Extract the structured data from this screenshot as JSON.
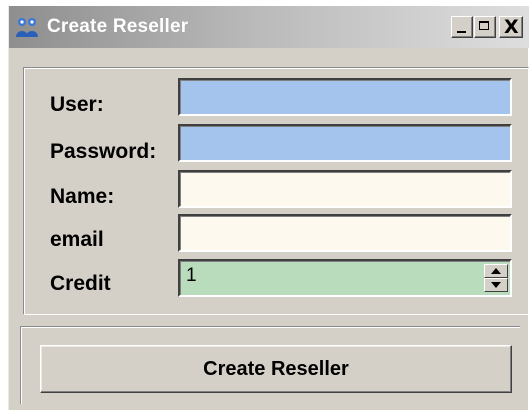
{
  "window": {
    "title": "Create Reseller",
    "controls": {
      "minimize_icon": "minimize-icon",
      "maximize_icon": "maximize-icon",
      "close_label": "X"
    }
  },
  "form": {
    "user": {
      "label": "User:",
      "value": ""
    },
    "password": {
      "label": "Password:",
      "value": ""
    },
    "name": {
      "label": "Name:",
      "value": ""
    },
    "email": {
      "label": "email",
      "value": ""
    },
    "credit": {
      "label": "Credit",
      "value": "1"
    }
  },
  "actions": {
    "create_label": "Create Reseller"
  },
  "colors": {
    "window_bg": "#d4d0c8",
    "user_field_bg": "#a4c4ee",
    "text_field_bg": "#fdf9ef",
    "credit_field_bg": "#b8dcbc"
  }
}
